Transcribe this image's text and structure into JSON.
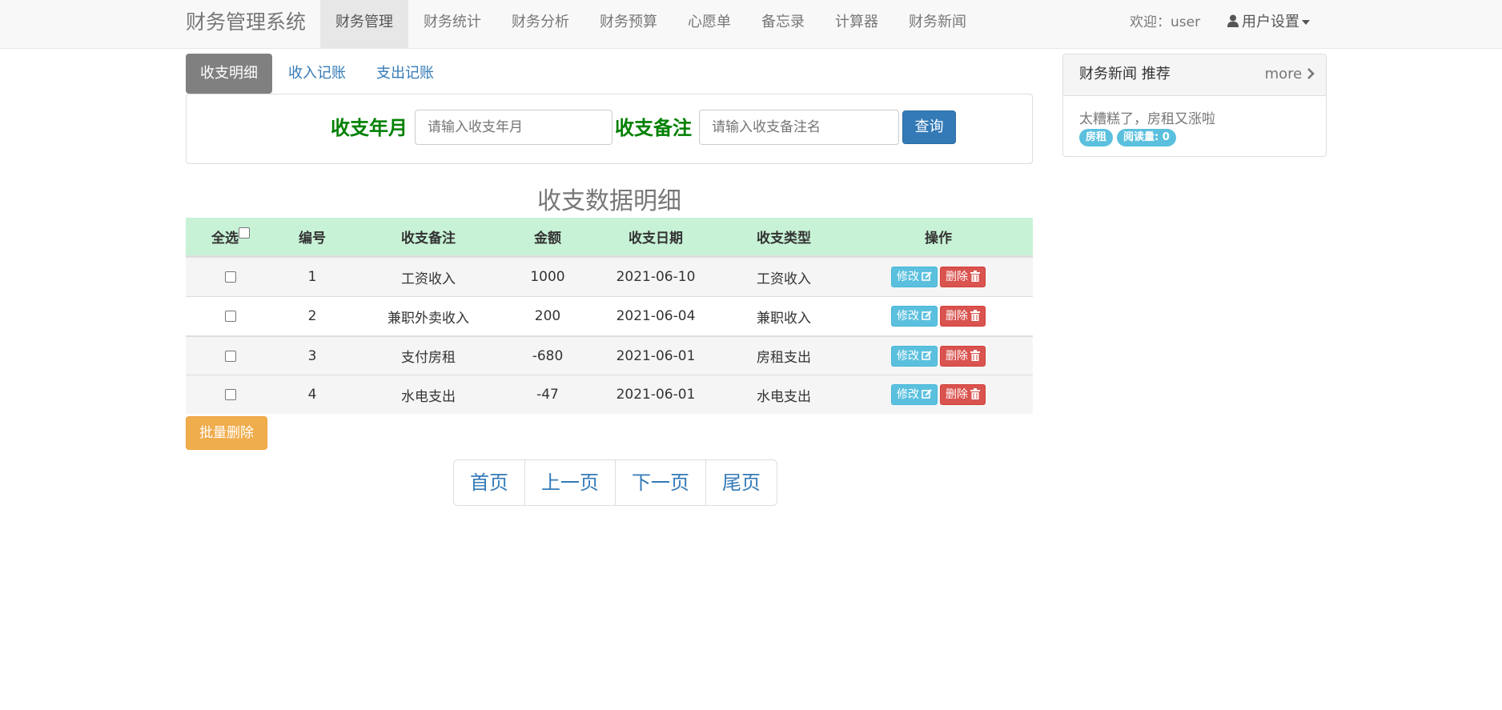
{
  "navbar": {
    "brand": "财务管理系统",
    "items": [
      {
        "label": "财务管理",
        "active": true
      },
      {
        "label": "财务统计"
      },
      {
        "label": "财务分析"
      },
      {
        "label": "财务预算"
      },
      {
        "label": "心愿单"
      },
      {
        "label": "备忘录"
      },
      {
        "label": "计算器"
      },
      {
        "label": "财务新闻"
      }
    ],
    "welcome": "欢迎：user",
    "user_settings": "用户设置"
  },
  "tabs": [
    {
      "label": "收支明细",
      "active": true
    },
    {
      "label": "收入记账"
    },
    {
      "label": "支出记账"
    }
  ],
  "search": {
    "month_label": "收支年月",
    "month_placeholder": "请输入收支年月",
    "note_label": "收支备注",
    "note_placeholder": "请输入收支备注名",
    "query_button": "查询"
  },
  "table": {
    "title": "收支数据明细",
    "headers": {
      "select_all": "全选",
      "id": "编号",
      "note": "收支备注",
      "amount": "金额",
      "date": "收支日期",
      "type": "收支类型",
      "actions": "操作"
    },
    "edit_label": "修改",
    "delete_label": "删除",
    "rows": [
      {
        "id": "1",
        "note": "工资收入",
        "amount": "1000",
        "date": "2021-06-10",
        "type": "工资收入"
      },
      {
        "id": "2",
        "note": "兼职外卖收入",
        "amount": "200",
        "date": "2021-06-04",
        "type": "兼职收入"
      },
      {
        "id": "3",
        "note": "支付房租",
        "amount": "-680",
        "date": "2021-06-01",
        "type": "房租支出"
      },
      {
        "id": "4",
        "note": "水电支出",
        "amount": "-47",
        "date": "2021-06-01",
        "type": "水电支出"
      }
    ],
    "batch_delete": "批量删除"
  },
  "pagination": {
    "first": "首页",
    "prev": "上一页",
    "next": "下一页",
    "last": "尾页"
  },
  "news": {
    "title": "财务新闻 推荐",
    "more": "more",
    "item_title": "太糟糕了，房租又涨啦",
    "tag": "房租",
    "views": "阅读量: 0"
  },
  "colors": {
    "primary": "#337ab7",
    "label_green": "#008000",
    "header_green": "#c8f2d6",
    "info": "#5bc0de",
    "danger": "#d9534f",
    "warning": "#f0ad4e"
  }
}
